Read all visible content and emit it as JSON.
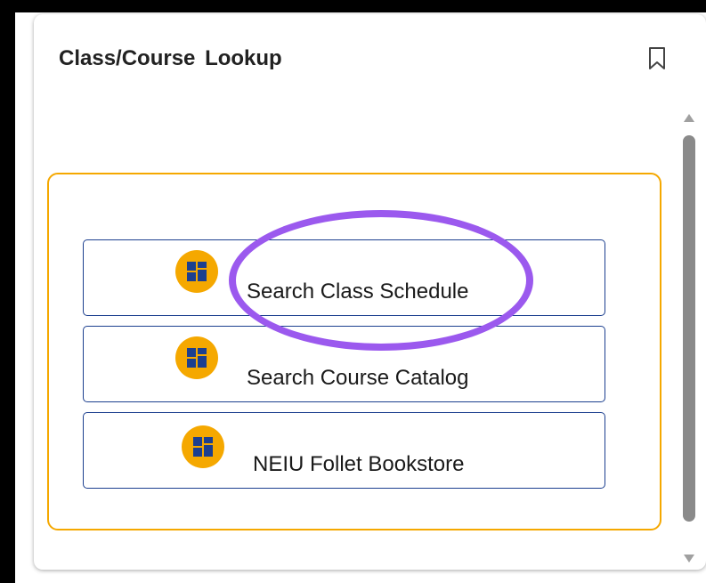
{
  "widget": {
    "title": "Class/Course Lookup",
    "bookmark_icon": "bookmark-icon"
  },
  "links": [
    {
      "label": "Search Class Schedule",
      "icon": "tile-grid-icon"
    },
    {
      "label": "Search Course Catalog",
      "icon": "tile-grid-icon"
    },
    {
      "label": "NEIU Follet Bookstore",
      "icon": "tile-grid-icon"
    }
  ],
  "colors": {
    "accent_gold": "#f5a800",
    "button_border_navy": "#1c3f8f",
    "icon_square_blue": "#1c3f8f",
    "annotation_purple": "#9b59ee"
  }
}
